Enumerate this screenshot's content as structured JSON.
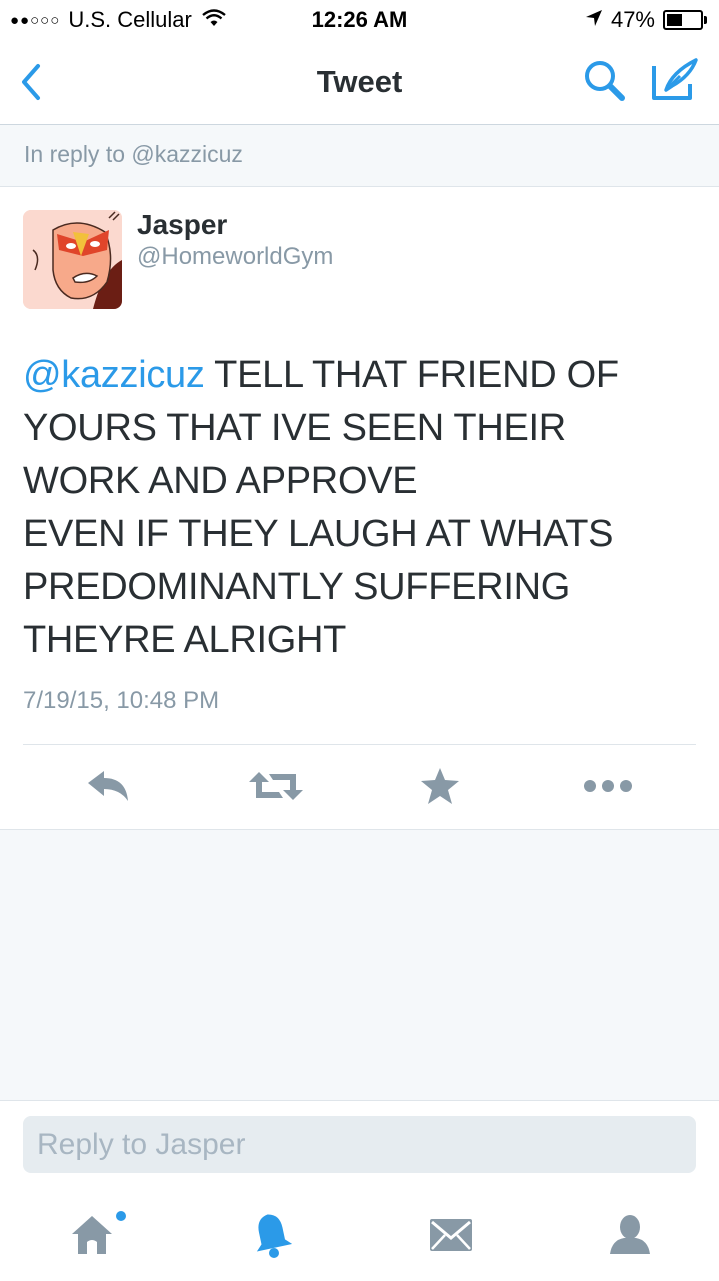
{
  "status_bar": {
    "signal": "●●○○○",
    "carrier": "U.S. Cellular",
    "time": "12:26 AM",
    "battery_text": "47%",
    "battery_level": 0.47
  },
  "nav": {
    "title": "Tweet",
    "icons": [
      "back-chevron-icon",
      "search-icon",
      "compose-icon"
    ]
  },
  "reply_context": "In reply to @kazzicuz",
  "tweet": {
    "author_name": "Jasper",
    "author_handle": "@HomeworldGym",
    "mention": "@kazzicuz",
    "body": " TELL THAT FRIEND OF YOURS THAT IVE SEEN THEIR WORK AND APPROVE\nEVEN IF THEY LAUGH AT WHATS PREDOMINANTLY SUFFERING\nTHEYRE ALRIGHT",
    "timestamp": "7/19/15, 10:48 PM",
    "actions": [
      "reply-icon",
      "retweet-icon",
      "favorite-star-icon",
      "more-icon"
    ]
  },
  "reply_box": {
    "placeholder": "Reply to Jasper"
  },
  "tab_bar": {
    "tabs": [
      "home-icon",
      "notifications-bell-icon",
      "messages-envelope-icon",
      "profile-icon"
    ],
    "home_has_unread": true
  },
  "colors": {
    "accent": "#2b9ae8",
    "text": "#292f33",
    "muted": "#8899a6",
    "icon_gray": "#8899a6",
    "background": "#f5f8fa"
  }
}
